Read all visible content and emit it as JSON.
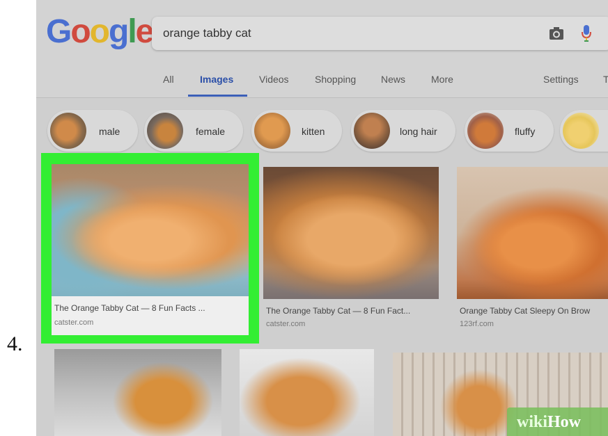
{
  "step_number": "4.",
  "logo": {
    "letters": [
      "G",
      "o",
      "o",
      "g",
      "l",
      "e"
    ],
    "colors": [
      "#4a6fd0",
      "#d04a3e",
      "#e2b62d",
      "#4a6fd0",
      "#3f9a52",
      "#d04a3e"
    ]
  },
  "search": {
    "query": "orange tabby cat",
    "camera_icon": "camera-icon",
    "mic_icon": "mic-icon"
  },
  "tabs": [
    {
      "label": "All",
      "active": false
    },
    {
      "label": "Images",
      "active": true
    },
    {
      "label": "Videos",
      "active": false
    },
    {
      "label": "Shopping",
      "active": false
    },
    {
      "label": "News",
      "active": false
    },
    {
      "label": "More",
      "active": false
    },
    {
      "label": "Settings",
      "active": false
    },
    {
      "label": "T",
      "active": false
    }
  ],
  "chips": [
    {
      "label": "male"
    },
    {
      "label": "female"
    },
    {
      "label": "kitten"
    },
    {
      "label": "long hair"
    },
    {
      "label": "fluffy"
    }
  ],
  "results": [
    {
      "title": "The Orange Tabby Cat — 8 Fun Facts ...",
      "source": "catster.com",
      "selected": true
    },
    {
      "title": "The Orange Tabby Cat — 8 Fun Fact...",
      "source": "catster.com",
      "selected": false
    },
    {
      "title": "Orange Tabby Cat Sleepy On Brow",
      "source": "123rf.com",
      "selected": false
    }
  ],
  "watermark": {
    "part1": "wiki",
    "part2": "How"
  },
  "colors": {
    "highlight": "#33ee33",
    "active_tab": "#2b4fa8"
  }
}
